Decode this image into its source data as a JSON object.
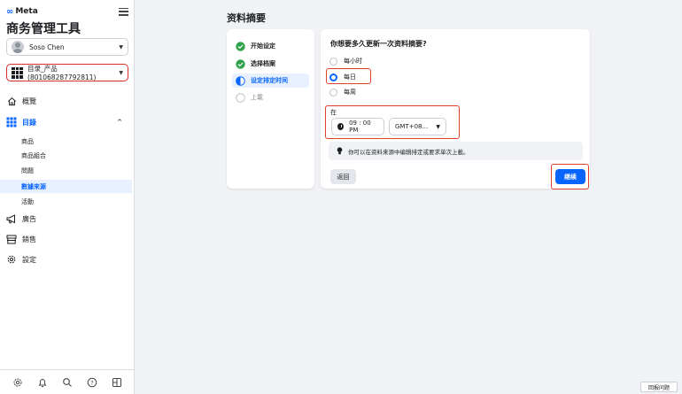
{
  "brand": {
    "logo_text": "Meta",
    "logo_mark": "∞"
  },
  "app": {
    "title": "商务管理工具"
  },
  "account": {
    "name": "Soso Chen"
  },
  "catalog": {
    "selected": "目录_产品(801068287792811)"
  },
  "nav": {
    "overview": "概覽",
    "catalog": "目錄",
    "catalog_sub": [
      "商品",
      "商品組合",
      "問題",
      "數據來源",
      "活動"
    ],
    "active_sub_index": 3,
    "ads": "廣告",
    "sales": "銷售",
    "settings": "設定"
  },
  "page": {
    "title": "资料摘要"
  },
  "steps": [
    {
      "label": "开始设定",
      "state": "done"
    },
    {
      "label": "选择档案",
      "state": "done"
    },
    {
      "label": "设定排定时间",
      "state": "current"
    },
    {
      "label": "上載",
      "state": "pending"
    }
  ],
  "form": {
    "question": "你想要多久更新一次资料摘要?",
    "options": [
      "每小时",
      "每日",
      "每周"
    ],
    "selected_index": 1,
    "at_label": "在",
    "time_value": "09 : 00 PM",
    "timezone_value": "GMT+08...",
    "info_text": "你可以在资料来源中编辑排定或要求单次上載。",
    "back_label": "返回",
    "continue_label": "继续"
  },
  "footer": {
    "report_label": "回报问题"
  },
  "colors": {
    "accent": "#0866ff",
    "highlight_red": "#e0412b",
    "success": "#31a24c"
  },
  "icons": [
    "meta-logo-icon",
    "hamburger-icon",
    "avatar-icon",
    "grid-icon",
    "home-icon",
    "megaphone-icon",
    "store-icon",
    "gear-icon",
    "bell-icon",
    "search-icon",
    "help-icon",
    "panel-icon",
    "check-circle-icon",
    "half-circle-icon",
    "empty-circle-icon",
    "clock-icon",
    "lightbulb-icon"
  ]
}
